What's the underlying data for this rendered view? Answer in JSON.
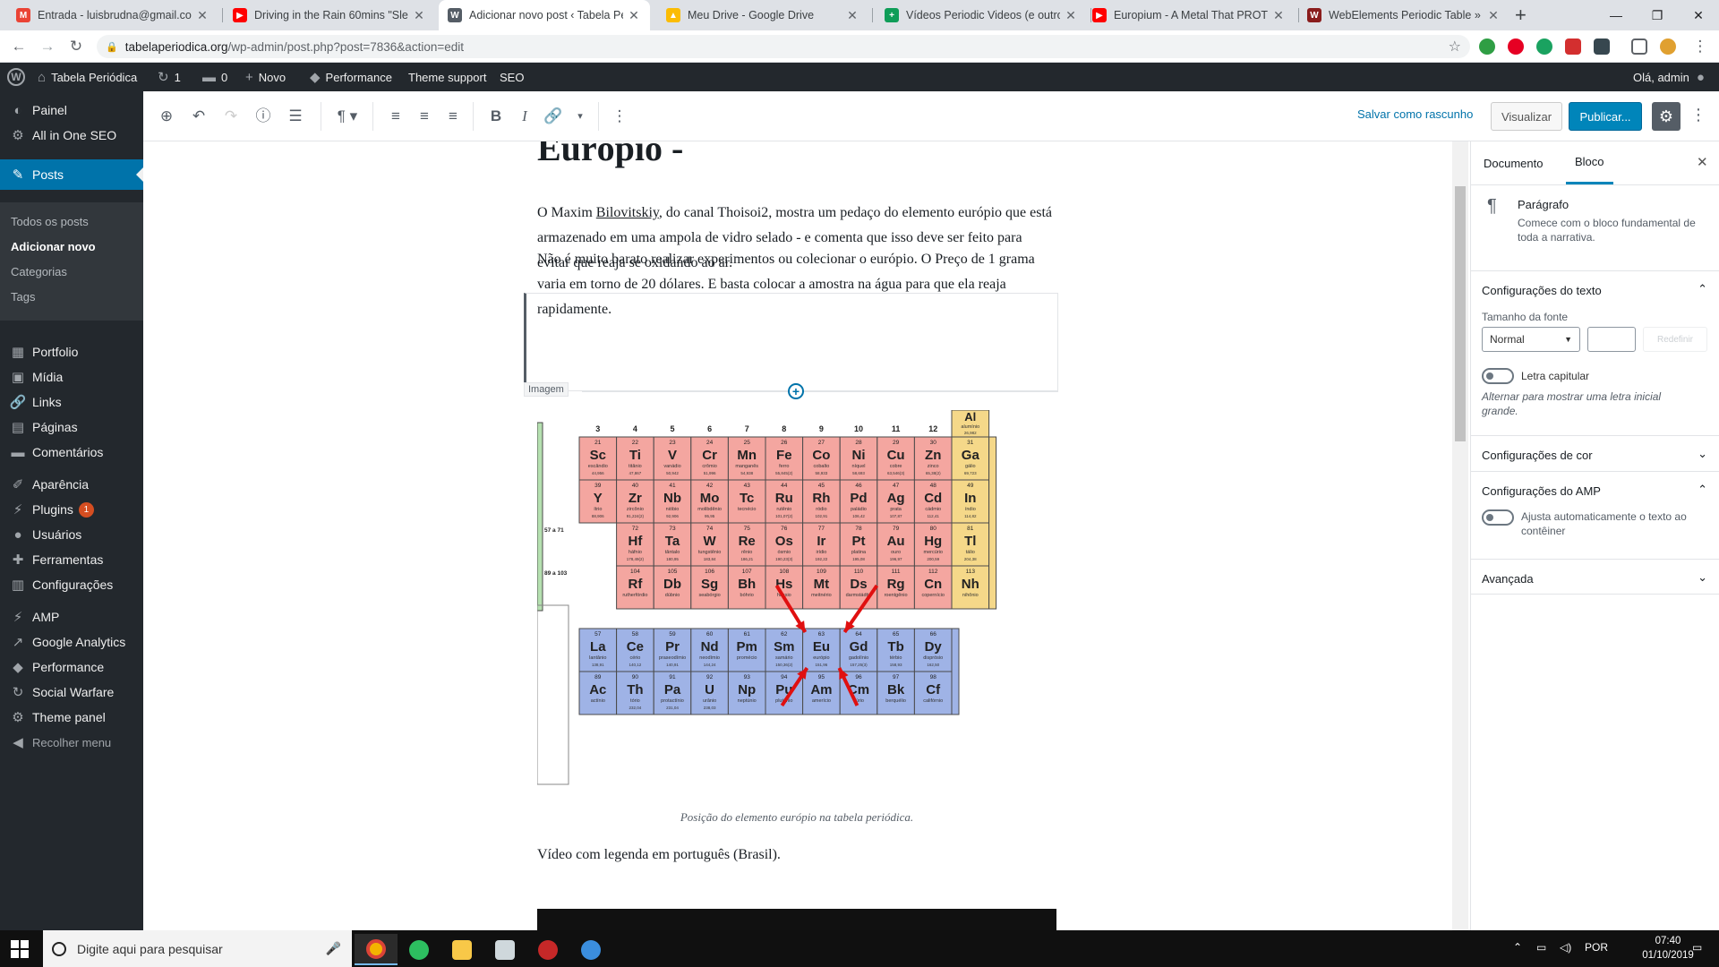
{
  "browser": {
    "tabs": [
      {
        "title": "Entrada - luisbrudna@gmail.com",
        "icon": "gmail-icon",
        "color": "#ea4335",
        "glyph": "M"
      },
      {
        "title": "Driving in the Rain 60mins \"Sleep",
        "icon": "youtube-icon",
        "color": "#ff0000",
        "glyph": "▶"
      },
      {
        "title": "Adicionar novo post ‹ Tabela Peri",
        "icon": "wordpress-icon",
        "color": "#555d66",
        "glyph": "W"
      },
      {
        "title": "Meu Drive - Google Drive",
        "icon": "google-drive-icon",
        "color": "#fbbc04",
        "glyph": "▲"
      },
      {
        "title": "Vídeos Periodic Videos (e outros",
        "icon": "google-sheets-icon",
        "color": "#0f9d58",
        "glyph": "+"
      },
      {
        "title": "Europium - A Metal That PROTEC",
        "icon": "youtube-icon",
        "color": "#ff0000",
        "glyph": "▶"
      },
      {
        "title": "WebElements Periodic Table » Eu",
        "icon": "webelements-icon",
        "color": "#8a1c1c",
        "glyph": "W"
      }
    ],
    "url_host": "tabelaperiodica.org",
    "url_path": "/wp-admin/post.php?post=7836&action=edit"
  },
  "adminbar": {
    "site_name": "Tabela Periódica",
    "updates": "1",
    "comments": "0",
    "new": "Novo",
    "performance": "Performance",
    "theme_support": "Theme support",
    "seo": "SEO",
    "greeting": "Olá, admin"
  },
  "menu": {
    "items": [
      {
        "label": "Painel",
        "icon": "dashboard-icon",
        "glyph": "◐"
      },
      {
        "label": "All in One SEO",
        "icon": "seo-gear-icon",
        "glyph": "⚙"
      },
      {
        "label": "Posts",
        "icon": "pin-icon",
        "glyph": "✎"
      },
      {
        "label": "Portfolio",
        "icon": "portfolio-icon",
        "glyph": "▦"
      },
      {
        "label": "Mídia",
        "icon": "media-icon",
        "glyph": "▣"
      },
      {
        "label": "Links",
        "icon": "links-icon",
        "glyph": "🔗"
      },
      {
        "label": "Páginas",
        "icon": "pages-icon",
        "glyph": "▤"
      },
      {
        "label": "Comentários",
        "icon": "comments-icon",
        "glyph": "▬"
      },
      {
        "label": "Aparência",
        "icon": "appearance-icon",
        "glyph": "✐"
      },
      {
        "label": "Plugins",
        "icon": "plugins-icon",
        "glyph": "⚡"
      },
      {
        "label": "Usuários",
        "icon": "users-icon",
        "glyph": "●"
      },
      {
        "label": "Ferramentas",
        "icon": "tools-icon",
        "glyph": "✚"
      },
      {
        "label": "Configurações",
        "icon": "settings-icon",
        "glyph": "▥"
      },
      {
        "label": "AMP",
        "icon": "amp-icon",
        "glyph": "⚡"
      },
      {
        "label": "Google Analytics",
        "icon": "analytics-icon",
        "glyph": "↗"
      },
      {
        "label": "Performance",
        "icon": "performance-icon",
        "glyph": "◆"
      },
      {
        "label": "Social Warfare",
        "icon": "social-warfare-icon",
        "glyph": "↻"
      },
      {
        "label": "Theme panel",
        "icon": "theme-panel-icon",
        "glyph": "⚙"
      },
      {
        "label": "Recolher menu",
        "icon": "collapse-icon",
        "glyph": "◀"
      }
    ],
    "plugins_badge": "1",
    "sub": [
      "Todos os posts",
      "Adicionar novo",
      "Categorias",
      "Tags"
    ]
  },
  "toolbar": {
    "save_draft": "Salvar como rascunho",
    "preview": "Visualizar",
    "publish": "Publicar..."
  },
  "post": {
    "title": "Európio -",
    "p1_pre": "O Maxim ",
    "p1_link": "Bilovitskiy",
    "p1_post": ", do canal Thoisoi2, mostra um pedaço do elemento európio que está armazenado em uma ampola de vidro selado - e comenta que isso deve ser feito para evitar que reaja se oxidando ao ar.",
    "p2": "Não é muito barato realizar experimentos ou colecionar o európio. O Preço de 1 grama varia em torno de 20 dólares. E basta colocar a amostra na água para que ela reaja rapidamente.",
    "image_label": "Imagem",
    "caption": "Posição do elemento európio na tabela periódica.",
    "p3": "Vídeo com legenda em português (Brasil)."
  },
  "ptable": {
    "groups": [
      "3",
      "4",
      "5",
      "6",
      "7",
      "8",
      "9",
      "10",
      "11",
      "12"
    ],
    "rows": [
      [
        [
          "21",
          "Sc",
          "escândio",
          "44,956"
        ],
        [
          "22",
          "Ti",
          "titânio",
          "47,867"
        ],
        [
          "23",
          "V",
          "vanádio",
          "50,942"
        ],
        [
          "24",
          "Cr",
          "crômio",
          "51,996"
        ],
        [
          "25",
          "Mn",
          "manganês",
          "54,938"
        ],
        [
          "26",
          "Fe",
          "ferro",
          "55,845(2)"
        ],
        [
          "27",
          "Co",
          "cobalto",
          "58,933"
        ],
        [
          "28",
          "Ni",
          "níquel",
          "58,693"
        ],
        [
          "29",
          "Cu",
          "cobre",
          "63,546(3)"
        ],
        [
          "30",
          "Zn",
          "zinco",
          "65,38(2)"
        ],
        [
          "31",
          "Ga",
          "gálio",
          "69,723"
        ]
      ],
      [
        [
          "39",
          "Y",
          "ítrio",
          "88,906"
        ],
        [
          "40",
          "Zr",
          "zircônio",
          "91,224(2)"
        ],
        [
          "41",
          "Nb",
          "nióbio",
          "92,906"
        ],
        [
          "42",
          "Mo",
          "molibdênio",
          "95,95"
        ],
        [
          "43",
          "Tc",
          "tecnécio",
          ""
        ],
        [
          "44",
          "Ru",
          "rutênio",
          "101,07(2)"
        ],
        [
          "45",
          "Rh",
          "ródio",
          "102,91"
        ],
        [
          "46",
          "Pd",
          "paládio",
          "106,42"
        ],
        [
          "47",
          "Ag",
          "prata",
          "107,87"
        ],
        [
          "48",
          "Cd",
          "cádmio",
          "112,41"
        ],
        [
          "49",
          "In",
          "índio",
          "114,82"
        ]
      ],
      [
        [
          "72",
          "Hf",
          "háfnio",
          "178,49(2)"
        ],
        [
          "73",
          "Ta",
          "tântalo",
          "180,95"
        ],
        [
          "74",
          "W",
          "tungstênio",
          "183,84"
        ],
        [
          "75",
          "Re",
          "rênio",
          "186,21"
        ],
        [
          "76",
          "Os",
          "ósmio",
          "190,23(3)"
        ],
        [
          "77",
          "Ir",
          "irídio",
          "192,22"
        ],
        [
          "78",
          "Pt",
          "platina",
          "195,08"
        ],
        [
          "79",
          "Au",
          "ouro",
          "196,97"
        ],
        [
          "80",
          "Hg",
          "mercúrio",
          "200,59"
        ],
        [
          "81",
          "Tl",
          "tálio",
          "204,38"
        ]
      ],
      [
        [
          "104",
          "Rf",
          "rutherfórdio",
          ""
        ],
        [
          "105",
          "Db",
          "dúbnio",
          ""
        ],
        [
          "106",
          "Sg",
          "seabórgio",
          ""
        ],
        [
          "107",
          "Bh",
          "bóhrio",
          ""
        ],
        [
          "108",
          "Hs",
          "hássio",
          ""
        ],
        [
          "109",
          "Mt",
          "meitnério",
          ""
        ],
        [
          "110",
          "Ds",
          "darmstádtio",
          ""
        ],
        [
          "111",
          "Rg",
          "roentgênio",
          ""
        ],
        [
          "112",
          "Cn",
          "copernício",
          ""
        ],
        [
          "113",
          "Nh",
          "nihônio",
          ""
        ]
      ]
    ],
    "top_partial": [
      "Al",
      "alumínio",
      "26,982"
    ],
    "range_57": "57 a 71",
    "range_89": "89 a 103",
    "lanth": [
      [
        "57",
        "La",
        "lantânio",
        "138,91"
      ],
      [
        "58",
        "Ce",
        "cério",
        "140,12"
      ],
      [
        "59",
        "Pr",
        "praseodímio",
        "140,91"
      ],
      [
        "60",
        "Nd",
        "neodímio",
        "144,24"
      ],
      [
        "61",
        "Pm",
        "promécio",
        ""
      ],
      [
        "62",
        "Sm",
        "samário",
        "150,36(2)"
      ],
      [
        "63",
        "Eu",
        "európio",
        "151,96"
      ],
      [
        "64",
        "Gd",
        "gadolínio",
        "157,25(3)"
      ],
      [
        "65",
        "Tb",
        "térbio",
        "158,93"
      ],
      [
        "66",
        "Dy",
        "disprósio",
        "162,50"
      ]
    ],
    "actin": [
      [
        "89",
        "Ac",
        "actínio",
        ""
      ],
      [
        "90",
        "Th",
        "tório",
        "232,04"
      ],
      [
        "91",
        "Pa",
        "protactínio",
        "231,04"
      ],
      [
        "92",
        "U",
        "urânio",
        "238,03"
      ],
      [
        "93",
        "Np",
        "neptúnio",
        ""
      ],
      [
        "94",
        "Pu",
        "plutônio",
        ""
      ],
      [
        "95",
        "Am",
        "amerício",
        ""
      ],
      [
        "96",
        "Cm",
        "cúrio",
        ""
      ],
      [
        "97",
        "Bk",
        "berquélio",
        ""
      ],
      [
        "98",
        "Cf",
        "califórnio",
        ""
      ]
    ]
  },
  "sidebar": {
    "tab_document": "Documento",
    "tab_block": "Bloco",
    "block_name": "Parágrafo",
    "block_desc": "Comece com o bloco fundamental de toda a narrativa.",
    "text_settings": "Configurações do texto",
    "font_size_label": "Tamanho da fonte",
    "font_size_value": "Normal",
    "reset": "Redefinir",
    "drop_cap": "Letra capitular",
    "drop_cap_help": "Alternar para mostrar uma letra inicial grande.",
    "color_settings": "Configurações de cor",
    "amp_settings": "Configurações do AMP",
    "amp_fit": "Ajusta automaticamente o texto ao contêiner",
    "advanced": "Avançada"
  },
  "taskbar": {
    "search_placeholder": "Digite aqui para pesquisar",
    "lang": "POR",
    "time": "07:40",
    "date": "01/10/2019",
    "notif": "1"
  },
  "colors": {
    "wp_blue": "#0073aa",
    "admin_dark": "#23282d",
    "transition_metal": "#f4a6a0",
    "lanthanide": "#9fb3e6",
    "post_transition": "#f5d889",
    "arrow_red": "#e01010"
  }
}
